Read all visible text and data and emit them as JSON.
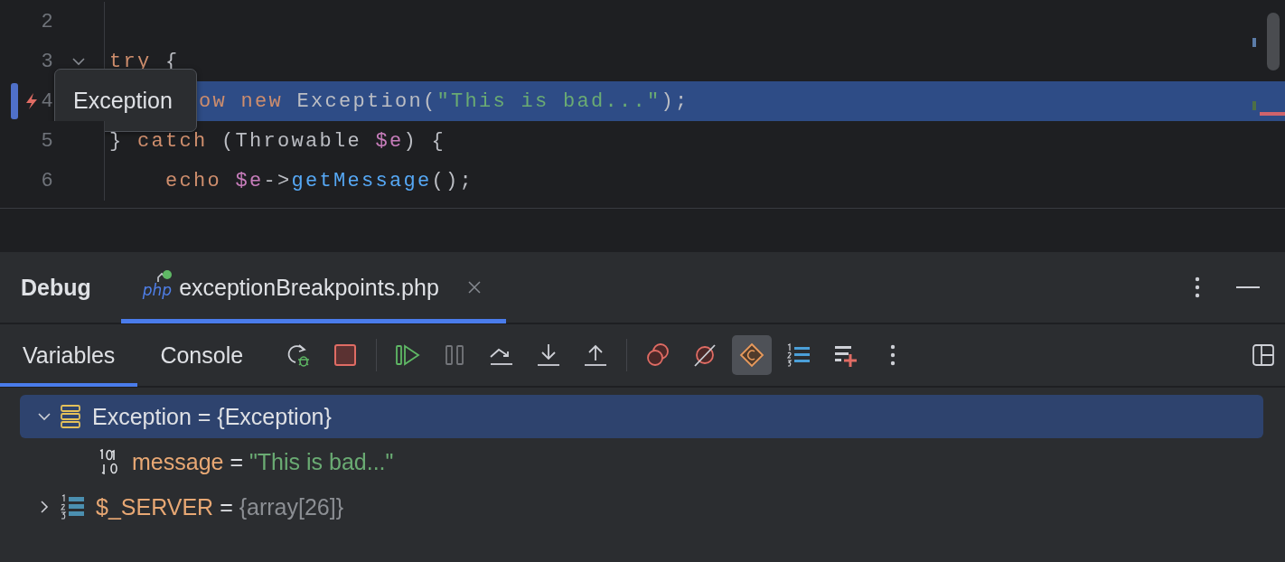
{
  "editor": {
    "lines": [
      {
        "number": "2",
        "fold": false,
        "current": false
      },
      {
        "number": "3",
        "fold": true,
        "current": false,
        "tokens": [
          {
            "text": "try",
            "kind": "keyword"
          },
          {
            "text": " {",
            "kind": "plain"
          }
        ]
      },
      {
        "number": "4",
        "fold": false,
        "current": true,
        "tokens": [
          {
            "text": "ow",
            "kind": "keyword"
          },
          {
            "text": " new",
            "kind": "keyword"
          },
          {
            "text": " Exception(",
            "kind": "plain"
          },
          {
            "text": "\"This is bad...\"",
            "kind": "string"
          },
          {
            "text": ");",
            "kind": "plain"
          }
        ]
      },
      {
        "number": "5",
        "fold": false,
        "current": false,
        "tokens": [
          {
            "text": "} ",
            "kind": "plain"
          },
          {
            "text": "catch",
            "kind": "keyword"
          },
          {
            "text": " (Throwable ",
            "kind": "plain"
          },
          {
            "text": "$e",
            "kind": "variable"
          },
          {
            "text": ") {",
            "kind": "plain"
          }
        ]
      },
      {
        "number": "6",
        "fold": false,
        "current": false,
        "tokens": [
          {
            "text": "    echo ",
            "kind": "keyword"
          },
          {
            "text": "$e",
            "kind": "variable"
          },
          {
            "text": "->",
            "kind": "plain"
          },
          {
            "text": "getMessage",
            "kind": "function"
          },
          {
            "text": "();",
            "kind": "plain"
          }
        ]
      }
    ],
    "tooltip": "Exception"
  },
  "debug": {
    "title": "Debug",
    "tabs": [
      {
        "badge": "php",
        "label": "exceptionBreakpoints.php",
        "selected": true
      }
    ],
    "views": [
      {
        "label": "Variables",
        "selected": true
      },
      {
        "label": "Console",
        "selected": false
      }
    ],
    "toolbar": [
      {
        "buttons": [
          {
            "kind": "rerun",
            "disabled": false,
            "on": false
          },
          {
            "kind": "stop",
            "disabled": false,
            "on": false
          }
        ]
      },
      {
        "buttons": [
          {
            "kind": "resume",
            "disabled": false,
            "on": false
          },
          {
            "kind": "pause",
            "disabled": true,
            "on": false
          },
          {
            "kind": "step-over",
            "disabled": false,
            "on": false
          },
          {
            "kind": "step-into",
            "disabled": false,
            "on": false
          },
          {
            "kind": "step-out",
            "disabled": false,
            "on": false
          }
        ]
      },
      {
        "buttons": [
          {
            "kind": "breakpoints",
            "disabled": false,
            "on": false
          },
          {
            "kind": "mute",
            "disabled": false,
            "on": false
          },
          {
            "kind": "c-diamond",
            "disabled": false,
            "on": true
          },
          {
            "kind": "numbered-list",
            "disabled": false,
            "on": false
          },
          {
            "kind": "add-watch",
            "disabled": false,
            "on": false
          },
          {
            "kind": "more",
            "disabled": false,
            "on": false
          }
        ]
      }
    ],
    "variables": [
      {
        "name": "Exception",
        "operator": "=",
        "value": "{Exception}",
        "kind": "object",
        "expanded": true,
        "selected": true,
        "children": [
          {
            "name": "message",
            "operator": "=",
            "value": "\"This is bad...\"",
            "kind": "string",
            "selected": false
          }
        ]
      },
      {
        "name": "$_SERVER",
        "operator": "=",
        "value": "{array[26]}",
        "kind": "array",
        "expanded": false,
        "selected": false
      }
    ]
  }
}
